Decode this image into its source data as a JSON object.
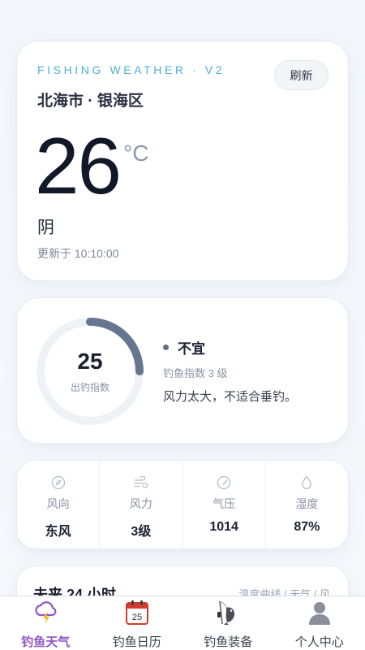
{
  "weather": {
    "app_tag": "FISHING WEATHER · V2",
    "refresh_label": "刷新",
    "location": "北海市 · 银海区",
    "temperature": "26",
    "unit": "°C",
    "condition": "阴",
    "updated": "更新于 10:10:00"
  },
  "fishing_index": {
    "value": "25",
    "progress": 0.25,
    "label": "出钓指数",
    "verdict": "不宜",
    "level": "钓鱼指数 3 级",
    "description": "风力太大，不适合垂钓。"
  },
  "stats": [
    {
      "icon": "compass-icon",
      "label": "风向",
      "value": "东风"
    },
    {
      "icon": "wind-icon",
      "label": "风力",
      "value": "3级"
    },
    {
      "icon": "gauge-icon",
      "label": "气压",
      "value": "1014"
    },
    {
      "icon": "droplet-icon",
      "label": "湿度",
      "value": "87%"
    }
  ],
  "forecast": {
    "title": "未来 24 小时",
    "subtitle": "温度曲线 / 天气 / 风"
  },
  "tabs": [
    {
      "label": "钓鱼天气",
      "icon": "cloud-lightning-icon",
      "active": true
    },
    {
      "label": "钓鱼日历",
      "icon": "calendar-icon",
      "calendar_day": "25"
    },
    {
      "label": "钓鱼装备",
      "icon": "fishing-gear-icon"
    },
    {
      "label": "个人中心",
      "icon": "user-icon"
    }
  ],
  "colors": {
    "accent": "#4fb0d9",
    "tab_active": "#8e55c9",
    "gauge_track": "#eef2f7",
    "gauge_fill": "#66768f"
  }
}
